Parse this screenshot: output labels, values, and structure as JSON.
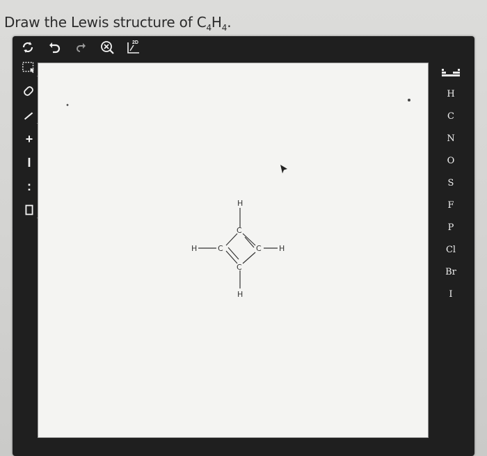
{
  "question": {
    "prefix": "Draw the Lewis structure of C",
    "sub1": "4",
    "mid": "H",
    "sub2": "4",
    "suffix": "."
  },
  "toolbar_top": {
    "badge_label": "2D"
  },
  "toolbar_left": {
    "add_label": "+",
    "single_label": "I",
    "lone_pair_label": ":",
    "charge_label": "•"
  },
  "elements": [
    "H",
    "C",
    "N",
    "O",
    "S",
    "F",
    "P",
    "Cl",
    "Br",
    "I"
  ],
  "molecule": {
    "atoms": {
      "h_left": "H",
      "c_left": "C",
      "c_top": "C",
      "c_right": "C",
      "c_bottom": "C",
      "h_top": "H",
      "h_right": "H",
      "h_bottom": "H"
    }
  },
  "colors": {
    "frame": "#1f1f1f",
    "canvas": "#f4f4f2",
    "icon": "#f2f2f2"
  }
}
